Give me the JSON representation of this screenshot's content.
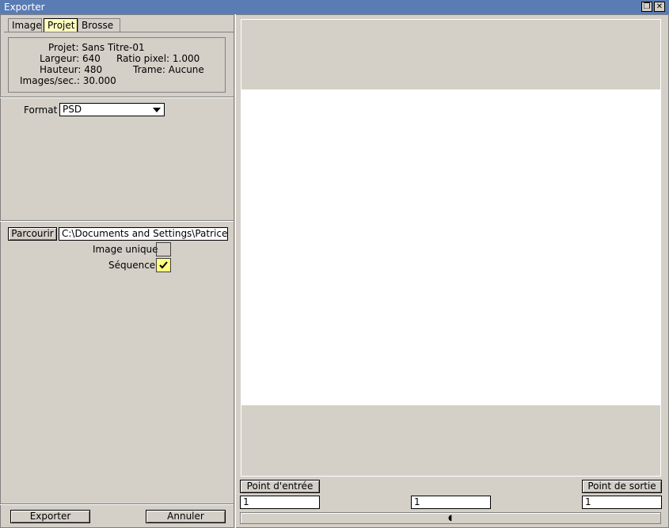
{
  "window": {
    "title": "Exporter"
  },
  "tabs": [
    {
      "label": "Image",
      "active": false
    },
    {
      "label": "Projet",
      "active": true
    },
    {
      "label": "Brosse",
      "active": false
    }
  ],
  "project_info": {
    "project": "Projet: Sans Titre-01",
    "width": "Largeur: 640",
    "height": "Hauteur: 480",
    "fps": "Images/sec.: 30.000",
    "pixel_ratio": "Ratio pixel: 1.000",
    "frame": "Trame: Aucune"
  },
  "format": {
    "label": "Format",
    "value": "PSD"
  },
  "browse": {
    "button": "Parcourir",
    "path": "C:\\Documents and Settings\\Patrice\\Bu"
  },
  "options": {
    "single_image": {
      "label": "Image unique",
      "checked": false
    },
    "sequence": {
      "label": "Séquence",
      "checked": true
    }
  },
  "timeline": {
    "in_point": "Point d'entrée",
    "out_point": "Point de sortie",
    "in_value": "1",
    "current_value": "1",
    "out_value": "1"
  },
  "actions": {
    "export": "Exporter",
    "cancel": "Annuler"
  }
}
